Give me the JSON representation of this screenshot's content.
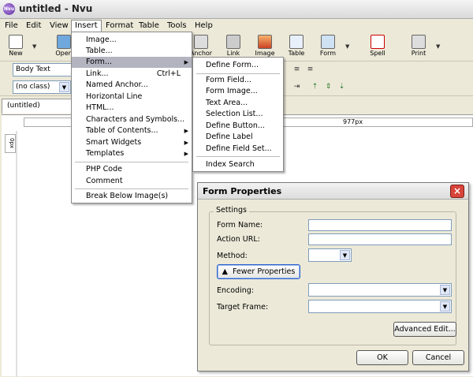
{
  "window": {
    "title": "untitled - Nvu",
    "app_icon": "nvu-logo-icon"
  },
  "menubar": [
    "File",
    "Edit",
    "View",
    "Insert",
    "Format",
    "Table",
    "Tools",
    "Help"
  ],
  "toolbar": {
    "new": "New",
    "open": "Open",
    "anchor": "Anchor",
    "link": "Link",
    "image": "Image",
    "table": "Table",
    "form": "Form",
    "spell": "Spell",
    "print": "Print"
  },
  "format": {
    "paragraph": "Body Text",
    "class": "(no class)"
  },
  "tab": {
    "label": "(untitled)"
  },
  "ruler": {
    "width_label": "977px",
    "vertical_label": "0px"
  },
  "insert_menu": {
    "image": "Image...",
    "table": "Table...",
    "form": "Form...",
    "link": "Link...",
    "link_shortcut": "Ctrl+L",
    "named_anchor": "Named Anchor...",
    "horizontal_line": "Horizontal Line",
    "html": "HTML...",
    "characters": "Characters and Symbols...",
    "toc": "Table of Contents...",
    "smart_widgets": "Smart Widgets",
    "templates": "Templates",
    "php_code": "PHP Code",
    "comment": "Comment",
    "break_below": "Break Below Image(s)"
  },
  "form_submenu": {
    "define_form": "Define Form...",
    "form_field": "Form Field...",
    "form_image": "Form Image...",
    "text_area": "Text Area...",
    "selection_list": "Selection List...",
    "define_button": "Define Button...",
    "define_label": "Define Label",
    "define_field_set": "Define Field Set...",
    "index_search": "Index Search"
  },
  "dialog": {
    "title": "Form Properties",
    "close": "×",
    "settings_legend": "Settings",
    "form_name_label": "Form Name:",
    "form_name_value": "",
    "action_url_label": "Action URL:",
    "action_url_value": "",
    "method_label": "Method:",
    "method_value": "",
    "fewer_button": "Fewer Properties",
    "encoding_label": "Encoding:",
    "encoding_value": "",
    "target_frame_label": "Target Frame:",
    "target_frame_value": "",
    "advanced_edit": "Advanced Edit...",
    "ok": "OK",
    "cancel": "Cancel"
  }
}
